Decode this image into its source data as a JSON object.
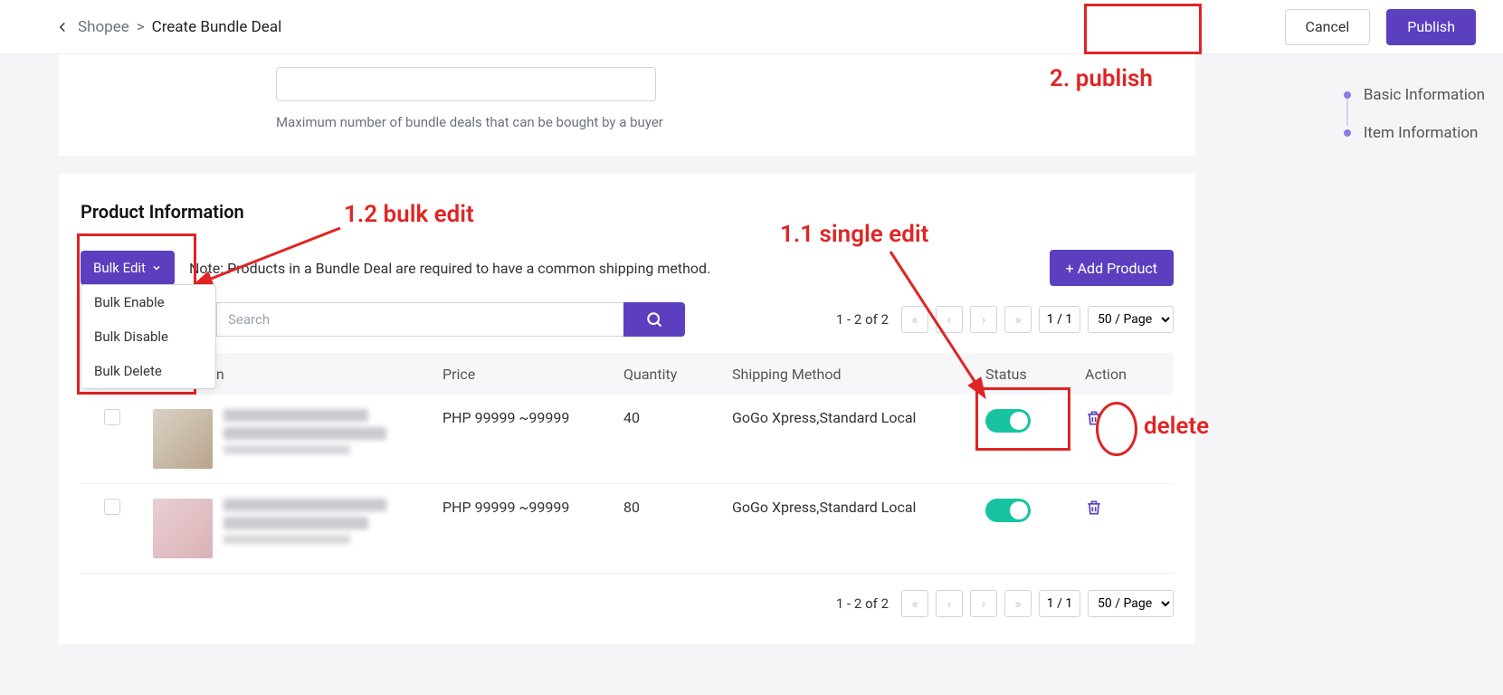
{
  "breadcrumb": {
    "root": "Shopee",
    "sep": ">",
    "current": "Create Bundle Deal"
  },
  "actions": {
    "cancel": "Cancel",
    "publish": "Publish"
  },
  "sidenav": {
    "basic": "Basic Information",
    "item": "Item Information"
  },
  "helper_text": "Maximum number of bundle deals that can be bought by a buyer",
  "section_title": "Product Information",
  "bulk": {
    "button": "Bulk Edit",
    "menu": [
      "Bulk Enable",
      "Bulk Disable",
      "Bulk Delete"
    ]
  },
  "note": "Note: Products in a Bundle Deal are required to have a common shipping method.",
  "add_product": "+ Add Product",
  "search": {
    "placeholder": "Search"
  },
  "pagination": {
    "range": "1 - 2 of 2",
    "page": "1 / 1",
    "per_page": "50 / Page"
  },
  "table": {
    "headers": {
      "info": "nformation",
      "price": "Price",
      "qty": "Quantity",
      "ship": "Shipping Method",
      "status": "Status",
      "action": "Action"
    },
    "rows": [
      {
        "price": "PHP 99999 ~99999",
        "qty": "40",
        "ship": "GoGo Xpress,Standard Local",
        "status_on": true
      },
      {
        "price": "PHP 99999 ~99999",
        "qty": "80",
        "ship": "GoGo Xpress,Standard Local",
        "status_on": true
      }
    ]
  },
  "annotations": {
    "single_edit": "1.1 single edit",
    "bulk_edit": "1.2 bulk edit",
    "publish": "2. publish",
    "delete": "delete"
  }
}
